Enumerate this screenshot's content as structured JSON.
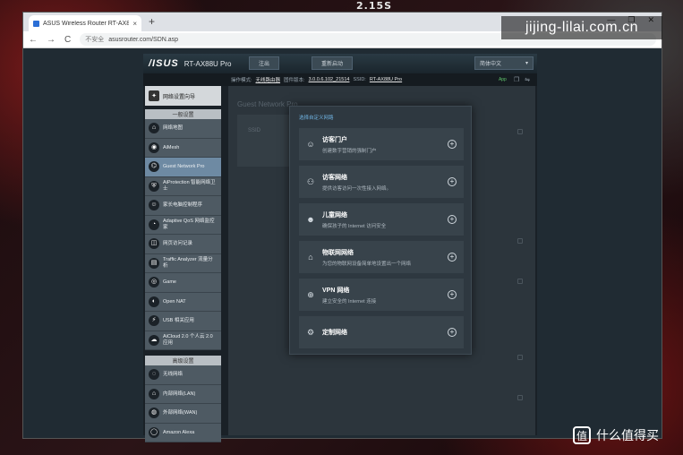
{
  "wallpaper_text": "2.15S",
  "browser": {
    "tab_title": "ASUS Wireless Router RT-AX8...",
    "tab_close": "×",
    "new_tab": "+",
    "win_controls": [
      "—",
      "❐",
      "✕"
    ],
    "nav": [
      "←",
      "→",
      "C"
    ],
    "insecure_label": "不安全",
    "url": "asusrouter.com/SDN.asp"
  },
  "router": {
    "brand": "/ISUS",
    "model": "RT-AX88U Pro",
    "logout_label": "注出",
    "reboot_label": "重新启动",
    "language": "简体中文",
    "language_caret": "▾",
    "info": {
      "mode_label": "操作模式:",
      "mode_value": "无线路由器",
      "firmware_label": "固件版本:",
      "firmware_value": "3.0.0.6.102_21514",
      "ssid_label": "SSID:",
      "ssid_value": "RT-AX88U Pro",
      "app_label": "App"
    },
    "sidebar": {
      "quick_setup": "网络设置向导",
      "general_header": "一般设置",
      "general_items": [
        {
          "label": "网络地图",
          "icon": "⌂"
        },
        {
          "label": "AiMesh",
          "icon": "◉"
        },
        {
          "label": "Guest Network Pro",
          "icon": "⌬"
        },
        {
          "label": "AiProtection 智能网络卫士",
          "icon": "⛨"
        },
        {
          "label": "家长电脑控制程序",
          "icon": "☺"
        },
        {
          "label": "Adaptive QoS 网络监控家",
          "icon": "◔"
        },
        {
          "label": "网页访问记录",
          "icon": "◫"
        },
        {
          "label": "Traffic Analyzer 流量分析",
          "icon": "▤"
        },
        {
          "label": "Game",
          "icon": "◎"
        },
        {
          "label": "Open NAT",
          "icon": "◐"
        },
        {
          "label": "USB 相关应用",
          "icon": "⚡"
        },
        {
          "label": "AiCloud 2.0 个人云 2.0 应用",
          "icon": "☁"
        }
      ],
      "advanced_header": "高级设置",
      "advanced_items": [
        {
          "label": "无线网络",
          "icon": "◌"
        },
        {
          "label": "内部网络(LAN)",
          "icon": "⌂"
        },
        {
          "label": "外部网络(WAN)",
          "icon": "◍"
        },
        {
          "label": "Amazon Alexa",
          "icon": "◯"
        }
      ]
    },
    "background": {
      "title": "Guest Network Pro",
      "row_text": "SSID"
    },
    "modal": {
      "title": "选择自定义网路",
      "options": [
        {
          "icon": "☺",
          "name": "访客门户",
          "desc": "创建数字营销的强制门户",
          "add": "+"
        },
        {
          "icon": "⚇",
          "name": "访客网络",
          "desc": "提供访客访问一次性接入网络。",
          "add": "+"
        },
        {
          "icon": "☻",
          "name": "儿童网络",
          "desc": "确保孩子的 Internet 访问安全",
          "add": "+"
        },
        {
          "icon": "⌂",
          "name": "物联网网络",
          "desc": "为您的物联网设备简单地设置出一个网络",
          "add": "+"
        },
        {
          "icon": "⊕",
          "name": "VPN 网络",
          "desc": "建立安全的 Internet 连接",
          "add": "+"
        },
        {
          "icon": "⚙",
          "name": "定制网络",
          "desc": "",
          "add": "+"
        }
      ]
    }
  },
  "watermarks": {
    "top": "jijing-lilai.com.cn",
    "bottom_logo": "值",
    "bottom_text": "什么值得买"
  }
}
